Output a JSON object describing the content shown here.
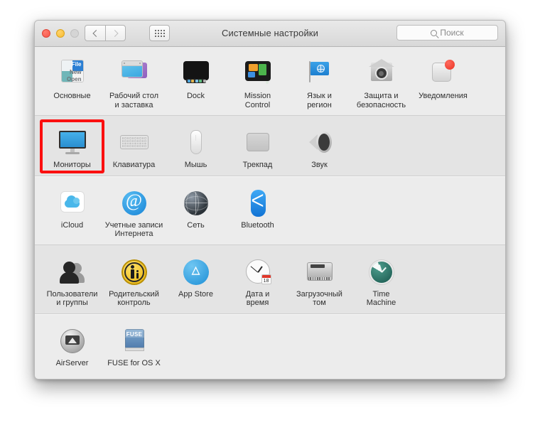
{
  "window": {
    "title": "Системные настройки",
    "traffic_lights": [
      "close",
      "minimize",
      "zoom"
    ],
    "nav_back_label": "Назад",
    "nav_forward_label": "Вперёд",
    "grid_button_label": "Показать все",
    "search": {
      "placeholder": "Поиск",
      "value": ""
    }
  },
  "highlight": {
    "target": "Мониторы",
    "color": "#fb0f0f"
  },
  "sections": [
    {
      "id": "personal",
      "items": [
        {
          "name": "Основные",
          "icon": "general-icon"
        },
        {
          "name": "Рабочий стол\nи заставка",
          "icon": "desktop-screensaver-icon"
        },
        {
          "name": "Dock",
          "icon": "dock-icon"
        },
        {
          "name": "Mission\nControl",
          "icon": "mission-control-icon"
        },
        {
          "name": "Язык и\nрегион",
          "icon": "language-region-icon"
        },
        {
          "name": "Защита и\nбезопасность",
          "icon": "security-privacy-icon"
        },
        {
          "name": "Уведомления",
          "icon": "notifications-icon"
        }
      ]
    },
    {
      "id": "hardware",
      "items": [
        {
          "name": "Мониторы",
          "icon": "displays-icon"
        },
        {
          "name": "Клавиатура",
          "icon": "keyboard-icon"
        },
        {
          "name": "Мышь",
          "icon": "mouse-icon"
        },
        {
          "name": "Трекпад",
          "icon": "trackpad-icon"
        },
        {
          "name": "Звук",
          "icon": "sound-icon"
        }
      ]
    },
    {
      "id": "internet",
      "items": [
        {
          "name": "iCloud",
          "icon": "icloud-icon"
        },
        {
          "name": "Учетные записи\nИнтернета",
          "icon": "internet-accounts-icon"
        },
        {
          "name": "Сеть",
          "icon": "network-icon"
        },
        {
          "name": "Bluetooth",
          "icon": "bluetooth-icon"
        }
      ]
    },
    {
      "id": "system",
      "items": [
        {
          "name": "Пользователи\nи группы",
          "icon": "users-groups-icon"
        },
        {
          "name": "Родительский\nконтроль",
          "icon": "parental-controls-icon"
        },
        {
          "name": "App Store",
          "icon": "app-store-icon"
        },
        {
          "name": "Дата и\nвремя",
          "icon": "date-time-icon"
        },
        {
          "name": "Загрузочный\nтом",
          "icon": "startup-disk-icon"
        },
        {
          "name": "Time\nMachine",
          "icon": "time-machine-icon"
        }
      ]
    },
    {
      "id": "other",
      "items": [
        {
          "name": "AirServer",
          "icon": "airserver-icon"
        },
        {
          "name": "FUSE for OS X",
          "icon": "fuse-icon"
        }
      ]
    }
  ]
}
